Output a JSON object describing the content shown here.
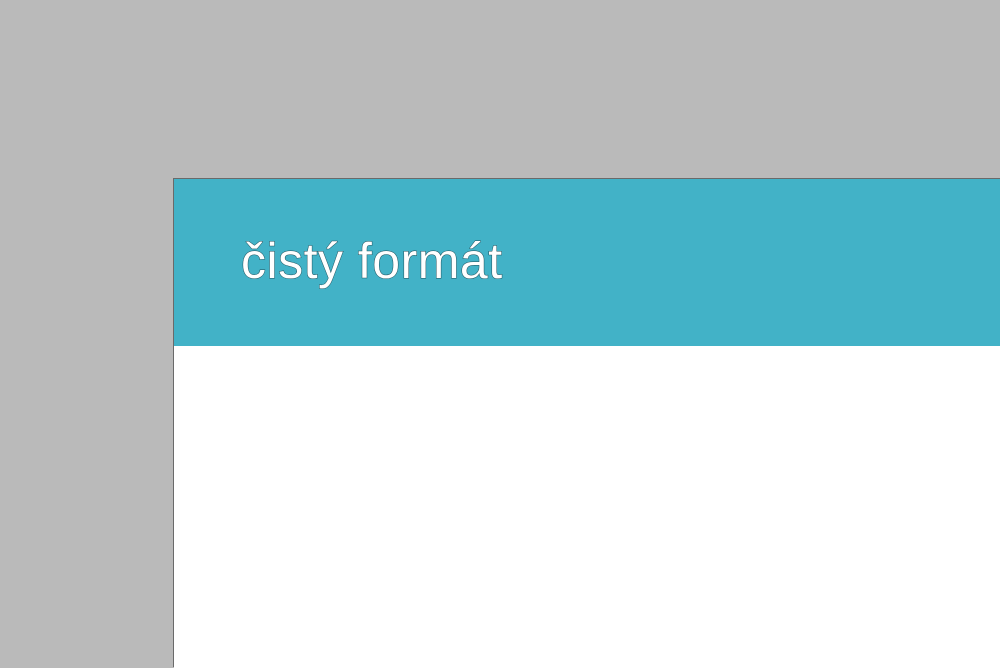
{
  "colors": {
    "workspace_background": "#bababa",
    "header_band": "#42b2c7",
    "page_background": "#ffffff",
    "title_text": "#ffffff"
  },
  "page": {
    "header": {
      "title": "čistý formát"
    }
  }
}
